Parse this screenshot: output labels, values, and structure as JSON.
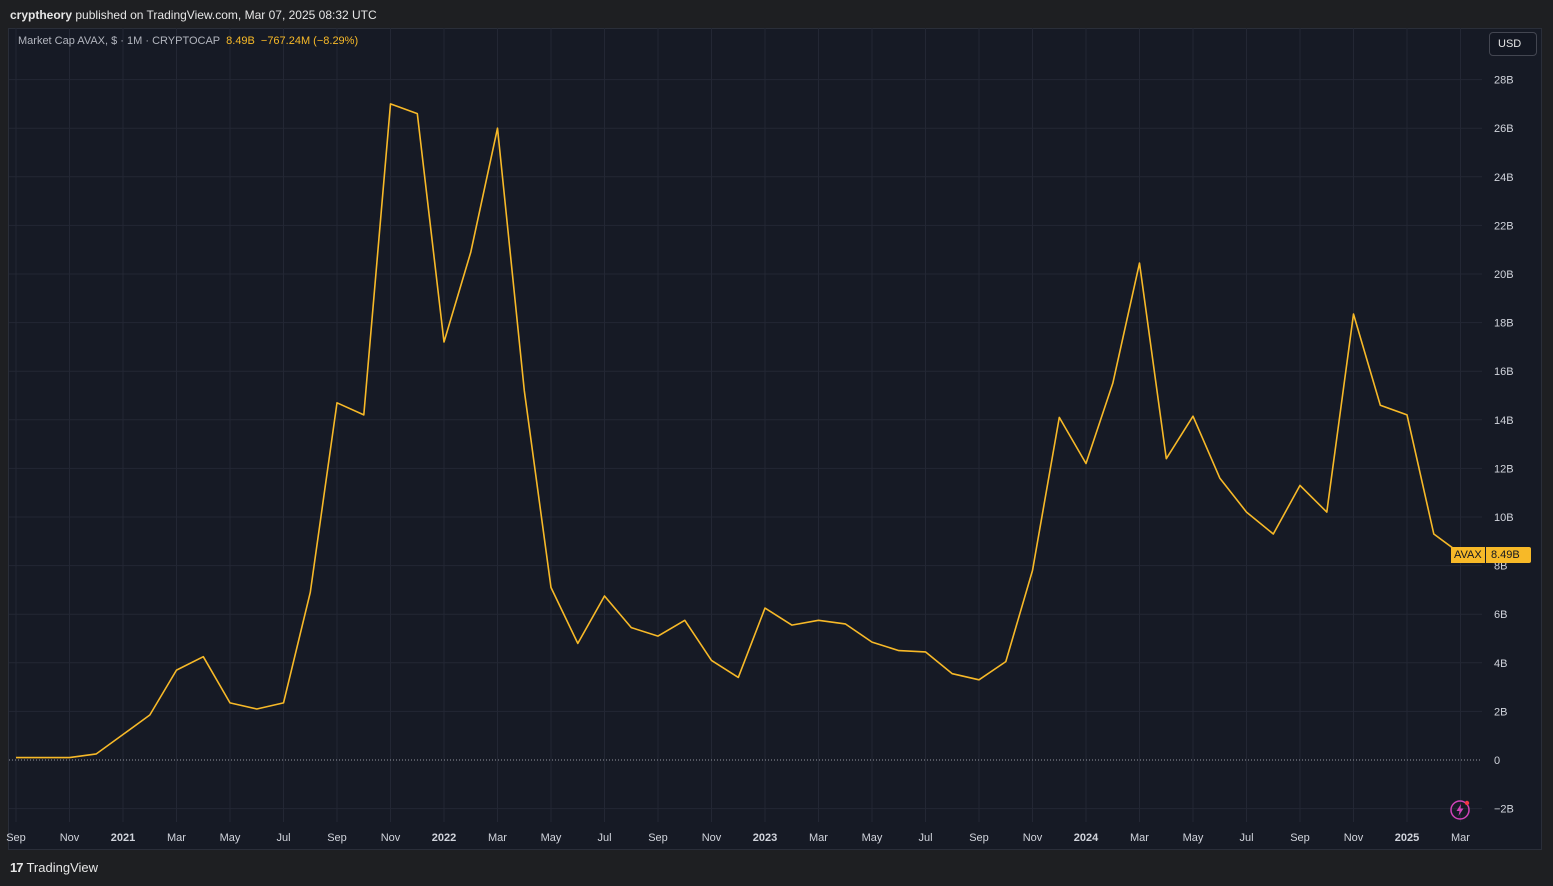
{
  "header": {
    "author": "cryptheory",
    "published_text": "published on TradingView.com, Mar 07, 2025 08:32 UTC"
  },
  "legend": {
    "symbol": "Market Cap AVAX, $ · 1M · CRYPTOCAP",
    "value": "8.49B",
    "change": "−767.24M (−8.29%)"
  },
  "currency_button": "USD",
  "price_tag": {
    "name": "AVAX",
    "value": "8.49B"
  },
  "footer": {
    "logo_mark": "17",
    "logo_text": "TradingView"
  },
  "colors": {
    "line": "#f7b928",
    "background": "#161a25",
    "grid": "#232734",
    "axis_text": "#d1d4dc"
  },
  "icons": [
    "lightning-bolt-icon",
    "tradingview-logo-icon"
  ],
  "chart_data": {
    "type": "line",
    "title": "Market Cap AVAX, $ · 1M · CRYPTOCAP",
    "xlabel": "",
    "ylabel": "",
    "ylim": [
      -2.3,
      30
    ],
    "y_unit": "B USD",
    "grid": true,
    "legend_position": "top-left",
    "x_ticks": [
      "Sep",
      "Nov",
      "2021",
      "Mar",
      "May",
      "Jul",
      "Sep",
      "Nov",
      "2022",
      "Mar",
      "May",
      "Jul",
      "Sep",
      "Nov",
      "2023",
      "Mar",
      "May",
      "Jul",
      "Sep",
      "Nov",
      "2024",
      "Mar",
      "May",
      "Jul",
      "Sep",
      "Nov",
      "2025",
      "Mar"
    ],
    "x_tick_bold": [
      "2021",
      "2022",
      "2023",
      "2024",
      "2025"
    ],
    "y_ticks": [
      {
        "value": 28,
        "label": "28B"
      },
      {
        "value": 26,
        "label": "26B"
      },
      {
        "value": 24,
        "label": "24B"
      },
      {
        "value": 22,
        "label": "22B"
      },
      {
        "value": 20,
        "label": "20B"
      },
      {
        "value": 18,
        "label": "18B"
      },
      {
        "value": 16,
        "label": "16B"
      },
      {
        "value": 14,
        "label": "14B"
      },
      {
        "value": 12,
        "label": "12B"
      },
      {
        "value": 10,
        "label": "10B"
      },
      {
        "value": 8,
        "label": "8B"
      },
      {
        "value": 6,
        "label": "6B"
      },
      {
        "value": 4,
        "label": "4B"
      },
      {
        "value": 2,
        "label": "2B"
      },
      {
        "value": 0,
        "label": "0"
      },
      {
        "value": -2,
        "label": "−2B"
      }
    ],
    "series": [
      {
        "values": [
          {
            "x": "2020-09",
            "y": 0.1
          },
          {
            "x": "2020-10",
            "y": 0.1
          },
          {
            "x": "2020-11",
            "y": 0.1
          },
          {
            "x": "2020-12",
            "y": 0.25
          },
          {
            "x": "2021-01",
            "y": 1.05
          },
          {
            "x": "2021-02",
            "y": 1.85
          },
          {
            "x": "2021-03",
            "y": 3.7
          },
          {
            "x": "2021-04",
            "y": 4.25
          },
          {
            "x": "2021-05",
            "y": 2.35
          },
          {
            "x": "2021-06",
            "y": 2.1
          },
          {
            "x": "2021-07",
            "y": 2.35
          },
          {
            "x": "2021-08",
            "y": 6.9
          },
          {
            "x": "2021-09",
            "y": 14.7
          },
          {
            "x": "2021-10",
            "y": 14.2
          },
          {
            "x": "2021-11",
            "y": 27.0
          },
          {
            "x": "2021-12",
            "y": 26.6
          },
          {
            "x": "2022-01",
            "y": 17.2
          },
          {
            "x": "2022-02",
            "y": 20.9
          },
          {
            "x": "2022-03",
            "y": 26.0
          },
          {
            "x": "2022-04",
            "y": 15.2
          },
          {
            "x": "2022-05",
            "y": 7.1
          },
          {
            "x": "2022-06",
            "y": 4.8
          },
          {
            "x": "2022-07",
            "y": 6.75
          },
          {
            "x": "2022-08",
            "y": 5.45
          },
          {
            "x": "2022-09",
            "y": 5.1
          },
          {
            "x": "2022-10",
            "y": 5.75
          },
          {
            "x": "2022-11",
            "y": 4.1
          },
          {
            "x": "2022-12",
            "y": 3.4
          },
          {
            "x": "2023-01",
            "y": 6.25
          },
          {
            "x": "2023-02",
            "y": 5.55
          },
          {
            "x": "2023-03",
            "y": 5.75
          },
          {
            "x": "2023-04",
            "y": 5.6
          },
          {
            "x": "2023-05",
            "y": 4.85
          },
          {
            "x": "2023-06",
            "y": 4.5
          },
          {
            "x": "2023-07",
            "y": 4.45
          },
          {
            "x": "2023-08",
            "y": 3.55
          },
          {
            "x": "2023-09",
            "y": 3.3
          },
          {
            "x": "2023-10",
            "y": 4.05
          },
          {
            "x": "2023-11",
            "y": 7.8
          },
          {
            "x": "2023-12",
            "y": 14.1
          },
          {
            "x": "2024-01",
            "y": 12.2
          },
          {
            "x": "2024-02",
            "y": 15.5
          },
          {
            "x": "2024-03",
            "y": 20.45
          },
          {
            "x": "2024-04",
            "y": 12.4
          },
          {
            "x": "2024-05",
            "y": 14.15
          },
          {
            "x": "2024-06",
            "y": 11.6
          },
          {
            "x": "2024-07",
            "y": 10.2
          },
          {
            "x": "2024-08",
            "y": 9.3
          },
          {
            "x": "2024-09",
            "y": 11.3
          },
          {
            "x": "2024-10",
            "y": 10.2
          },
          {
            "x": "2024-11",
            "y": 18.35
          },
          {
            "x": "2024-12",
            "y": 14.6
          },
          {
            "x": "2025-01",
            "y": 14.2
          },
          {
            "x": "2025-02",
            "y": 9.3
          },
          {
            "x": "2025-03",
            "y": 8.49
          }
        ]
      }
    ]
  }
}
